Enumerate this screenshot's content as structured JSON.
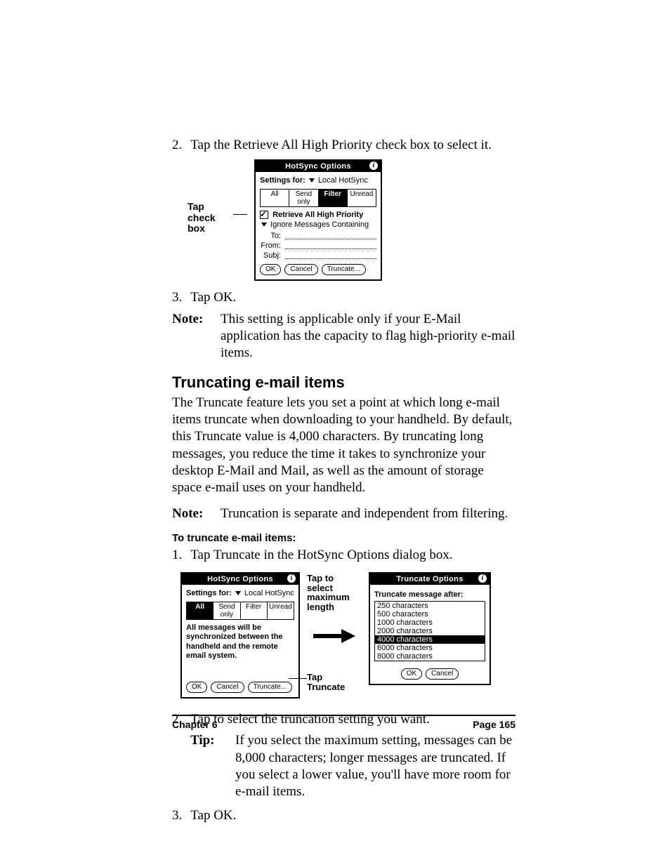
{
  "step2": {
    "num": "2.",
    "text": "Tap the Retrieve All High Priority check box to select it."
  },
  "fig1": {
    "callout": "Tap check box",
    "title": "HotSync Options",
    "settings_label": "Settings for:",
    "settings_value": "Local HotSync",
    "tabs": [
      "All",
      "Send only",
      "Filter",
      "Unread"
    ],
    "selected_tab": 2,
    "retrieve": "Retrieve All High Priority",
    "ignore": "Ignore Messages Containing",
    "to": "To:",
    "from": "From:",
    "subj": "Subj:",
    "ok": "OK",
    "cancel": "Cancel",
    "truncate": "Truncate..."
  },
  "step3": {
    "num": "3.",
    "text": "Tap OK."
  },
  "note1": {
    "label": "Note:",
    "text": "This setting is applicable only if your E-Mail application has the capacity to flag high-priority e-mail items."
  },
  "heading": "Truncating e-mail items",
  "para1": "The Truncate feature lets you set a point at which long e-mail items truncate when downloading to your handheld. By default, this Truncate value is 4,000 characters. By truncating long messages, you reduce the time it takes to synchronize your desktop E-Mail and Mail, as well as the amount of storage space e-mail uses on your handheld.",
  "note2": {
    "label": "Note:",
    "text": "Truncation is separate and independent from filtering."
  },
  "subheading": "To truncate e-mail items:",
  "tstep1": {
    "num": "1.",
    "text": "Tap Truncate in the HotSync Options dialog box."
  },
  "fig2": {
    "left": {
      "title": "HotSync Options",
      "settings_label": "Settings for:",
      "settings_value": "Local HotSync",
      "tabs": [
        "All",
        "Send only",
        "Filter",
        "Unread"
      ],
      "selected_tab": 0,
      "msg": "All messages will be synchronized between the handheld and the remote email system.",
      "ok": "OK",
      "cancel": "Cancel",
      "truncate": "Truncate..."
    },
    "mid_top": "Tap to select maximum length",
    "mid_bottom": "Tap Truncate",
    "right": {
      "title": "Truncate Options",
      "label": "Truncate message after:",
      "items": [
        "250 characters",
        "500 characters",
        "1000 characters",
        "2000 characters",
        "4000 characters",
        "6000 characters",
        "8000 characters"
      ],
      "selected": 4,
      "ok": "OK",
      "cancel": "Cancel"
    }
  },
  "tstep2": {
    "num": "2.",
    "text": "Tap to select the truncation setting you want."
  },
  "tip": {
    "label": "Tip:",
    "text": "If you select the maximum setting, messages can be 8,000 characters; longer messages are truncated. If you select a lower value, you'll have more room for e-mail items."
  },
  "tstep3": {
    "num": "3.",
    "text": "Tap OK."
  },
  "footer": {
    "left": "Chapter 6",
    "right": "Page 165"
  }
}
